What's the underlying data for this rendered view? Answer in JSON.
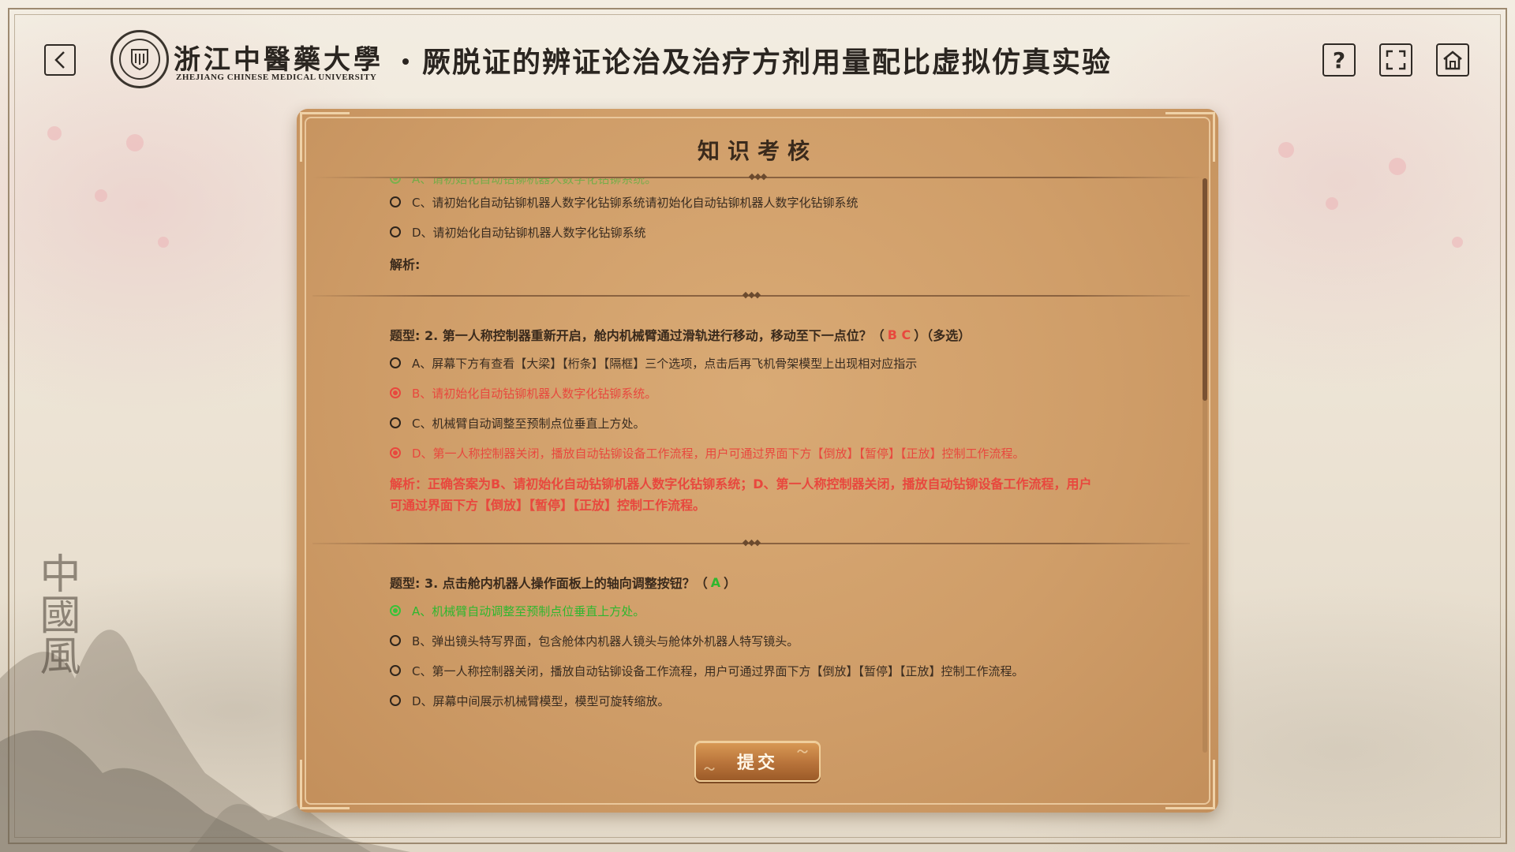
{
  "header": {
    "university_cn": "浙江中醫藥大學",
    "university_en": "ZHEJIANG CHINESE MEDICAL UNIVERSITY",
    "title": "厥脱证的辨证论治及治疗方剂用量配比虚拟仿真实验",
    "help_glyph": "?",
    "decor_calligraphy": "中國風"
  },
  "panel": {
    "title": "知识考核",
    "submit_label": "提交"
  },
  "q1": {
    "option_a_partial": "A、请初始化自动钻铆机器人数字化钻铆系统。",
    "option_c": "C、请初始化自动钻铆机器人数字化钻铆系统请初始化自动钻铆机器人数字化钻铆系统",
    "option_d": "D、请初始化自动钻铆机器人数字化钻铆系统",
    "analysis_label": "解析:"
  },
  "q2": {
    "prefix": "题型: 2. 第一人称控制器重新开启，舱内机械臂通过滑轨进行移动，移动至下一点位？（",
    "answer": "B C",
    "suffix": "）（多选）",
    "option_a": "A、屏幕下方有查看【大梁】【桁条】【隔框】三个选项，点击后再飞机骨架模型上出现相对应指示",
    "option_b": "B、请初始化自动钻铆机器人数字化钻铆系统。",
    "option_c": "C、机械臂自动调整至预制点位垂直上方处。",
    "option_d": "D、第一人称控制器关闭，播放自动钻铆设备工作流程，用户可通过界面下方【倒放】【暂停】【正放】控制工作流程。",
    "analysis": "解析：正确答案为B、请初始化自动钻铆机器人数字化钻铆系统；D、第一人称控制器关闭，播放自动钻铆设备工作流程，用户可通过界面下方【倒放】【暂停】【正放】控制工作流程。"
  },
  "q3": {
    "prefix": "题型: 3. 点击舱内机器人操作面板上的轴向调整按钮？（",
    "answer": "A",
    "suffix": "）",
    "option_a": "A、机械臂自动调整至预制点位垂直上方处。",
    "option_b": "B、弹出镜头特写界面，包含舱体内机器人镜头与舱体外机器人特写镜头。",
    "option_c": "C、第一人称控制器关闭，播放自动钻铆设备工作流程，用户可通过界面下方【倒放】【暂停】【正放】控制工作流程。",
    "option_d": "D、屏幕中间展示机械臂模型，模型可旋转缩放。"
  },
  "colors": {
    "wrong_selected": "#e8483e",
    "correct_selected": "#2fb72f",
    "panel_bg": "#cf9d68"
  },
  "scroll": {
    "position_fraction": 0.0
  }
}
